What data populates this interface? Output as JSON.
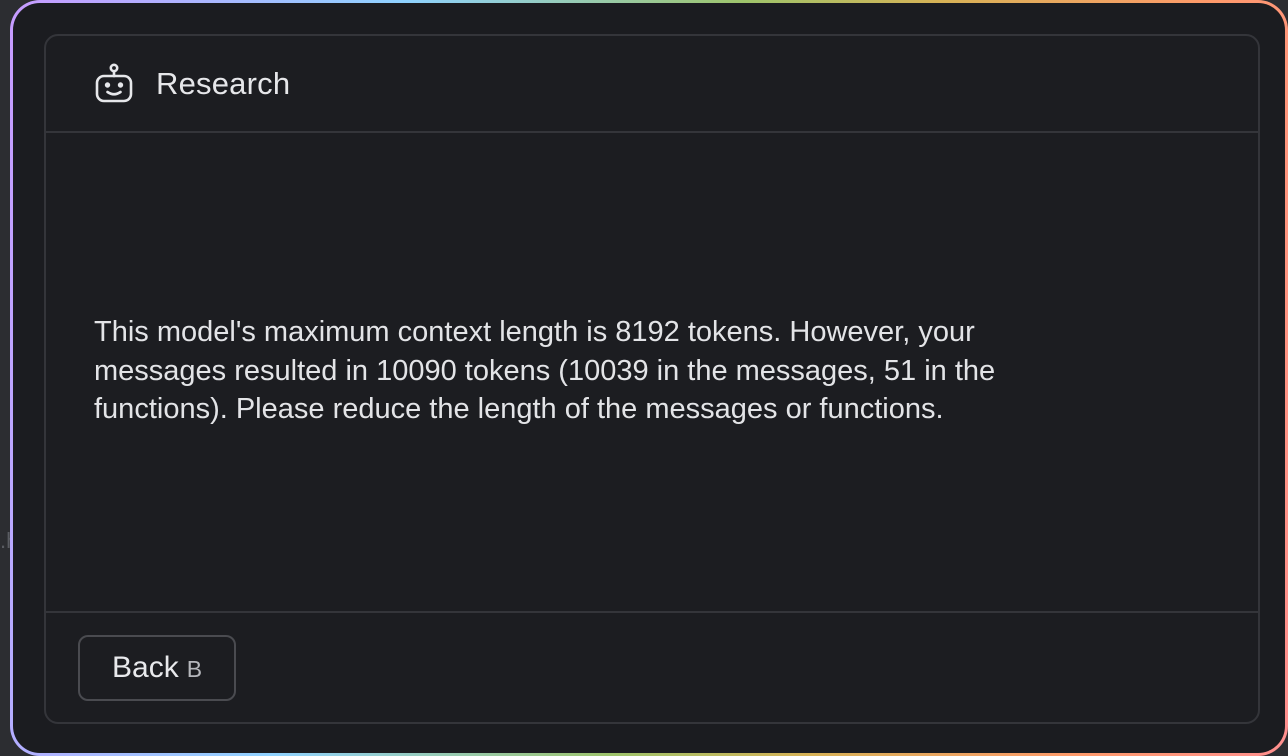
{
  "backdrop": {
    "fragment_text": ".h"
  },
  "header": {
    "icon": "robot-icon",
    "title": "Research"
  },
  "body": {
    "message": "This model's maximum context length is 8192 tokens. However, your messages resulted in 10090 tokens (10039 in the messages, 51 in the functions). Please reduce the length of the messages or functions."
  },
  "footer": {
    "back_label": "Back",
    "back_shortcut": "B"
  },
  "colors": {
    "background": "#1c1d21",
    "border": "#34353a",
    "text": "#e3e4e7"
  }
}
